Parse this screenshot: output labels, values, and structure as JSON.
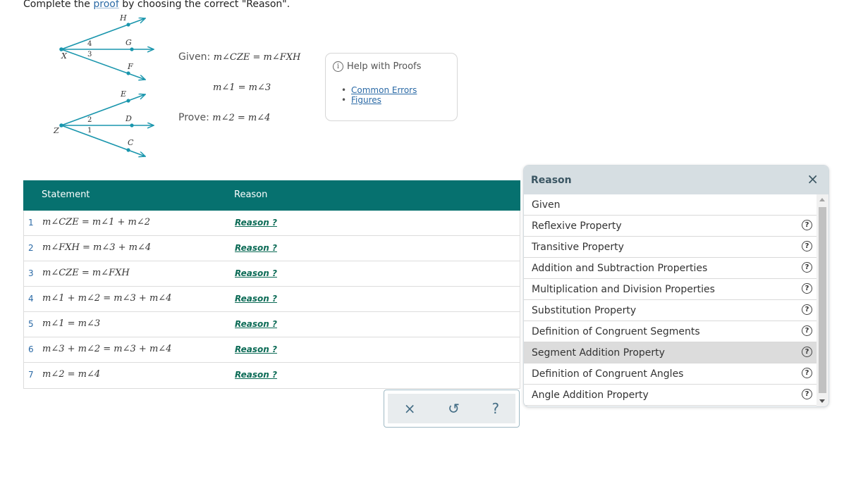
{
  "instruction": {
    "before": "Complete the ",
    "link": "proof",
    "after": " by choosing the correct \"Reason\"."
  },
  "figure": {
    "top_labels": {
      "vertex": "X",
      "ray1": "H",
      "ray2": "G",
      "ray3": "F",
      "angle_upper": "4",
      "angle_lower": "3"
    },
    "bottom_labels": {
      "vertex": "Z",
      "ray1": "E",
      "ray2": "D",
      "ray3": "C",
      "angle_upper": "2",
      "angle_lower": "1"
    },
    "ray_color": "#1a96ad"
  },
  "given": {
    "label1": "Given:",
    "expr1": "m∠CZE = m∠FXH",
    "expr2": "m∠1 = m∠3",
    "label2": "Prove:",
    "expr3": "m∠2 = m∠4"
  },
  "help": {
    "title": "Help with Proofs",
    "links": [
      "Common Errors",
      "Figures"
    ]
  },
  "table": {
    "headers": {
      "statement": "Statement",
      "reason": "Reason"
    },
    "header_color": "#06716f",
    "rows": [
      {
        "num": "1",
        "statement": "m∠CZE = m∠1 + m∠2",
        "reason": "Reason ?"
      },
      {
        "num": "2",
        "statement": "m∠FXH = m∠3 + m∠4",
        "reason": "Reason ?"
      },
      {
        "num": "3",
        "statement": "m∠CZE = m∠FXH",
        "reason": "Reason ?"
      },
      {
        "num": "4",
        "statement": "m∠1 + m∠2 = m∠3 + m∠4",
        "reason": "Reason ?"
      },
      {
        "num": "5",
        "statement": "m∠1 = m∠3",
        "reason": "Reason ?"
      },
      {
        "num": "6",
        "statement": "m∠3 + m∠2 = m∠3 + m∠4",
        "reason": "Reason ?"
      },
      {
        "num": "7",
        "statement": "m∠2 = m∠4",
        "reason": "Reason ?"
      }
    ]
  },
  "toolbar": {
    "clear": "×",
    "undo": "↺",
    "help": "?"
  },
  "reason_panel": {
    "title": "Reason",
    "close": "×",
    "items": [
      {
        "label": "Given",
        "has_help": false,
        "selected": false
      },
      {
        "label": "Reflexive Property",
        "has_help": true,
        "selected": false
      },
      {
        "label": "Transitive Property",
        "has_help": true,
        "selected": false
      },
      {
        "label": "Addition and Subtraction Properties",
        "has_help": true,
        "selected": false
      },
      {
        "label": "Multiplication and Division Properties",
        "has_help": true,
        "selected": false
      },
      {
        "label": "Substitution Property",
        "has_help": true,
        "selected": false
      },
      {
        "label": "Definition of Congruent Segments",
        "has_help": true,
        "selected": false
      },
      {
        "label": "Segment Addition Property",
        "has_help": true,
        "selected": true
      },
      {
        "label": "Definition of Congruent Angles",
        "has_help": true,
        "selected": false
      },
      {
        "label": "Angle Addition Property",
        "has_help": true,
        "selected": false
      }
    ]
  }
}
